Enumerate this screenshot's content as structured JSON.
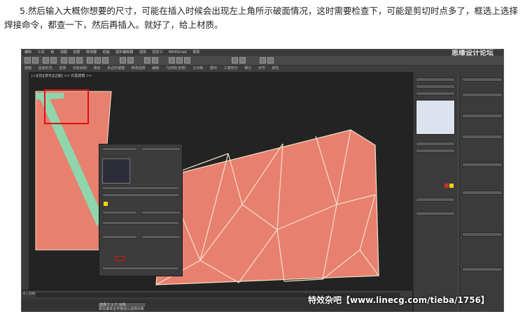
{
  "caption": "5.然后输入大概你想要的尺寸，可能在插入时候会出现左上角所示破面情况，这时需要检查下，可能是剪切时点多了，框选上选择焊接命令，都查一下，然后再插入。就好了，给上材质。",
  "screenshot": {
    "site_watermark_top": "思缘设计论坛",
    "menu": [
      "编辑",
      "工具",
      "组",
      "视图",
      "创建",
      "修改器",
      "动画",
      "图形编辑器",
      "渲染",
      "自定义",
      "MAXScript",
      "帮助"
    ],
    "ribbon": [
      "建模",
      "自由形式",
      "选择",
      "对象绘制",
      "填充"
    ],
    "ribbon_sub": [
      "多边形建模",
      "修改选择",
      "编辑",
      "几何体(全部)",
      "子对象",
      "循环",
      "三角剖分",
      "细分",
      "对齐",
      "属性"
    ],
    "viewport_label": "[+][前][真实][边面] << 石墨建模 >>",
    "status_selected": "选择了 1 个 对象",
    "status_hint": "单击或单击并拖动以选择对象",
    "timeline_frame": "0 / 100",
    "colors": {
      "mesh_fill": "#e8806f",
      "mesh_edge": "#f3e1c9",
      "seam_green": "#8fd6ad",
      "highlight_red": "#e01010"
    }
  },
  "bottom_watermark": "特效杂吧【www.linecg.com/tieba/1756】"
}
